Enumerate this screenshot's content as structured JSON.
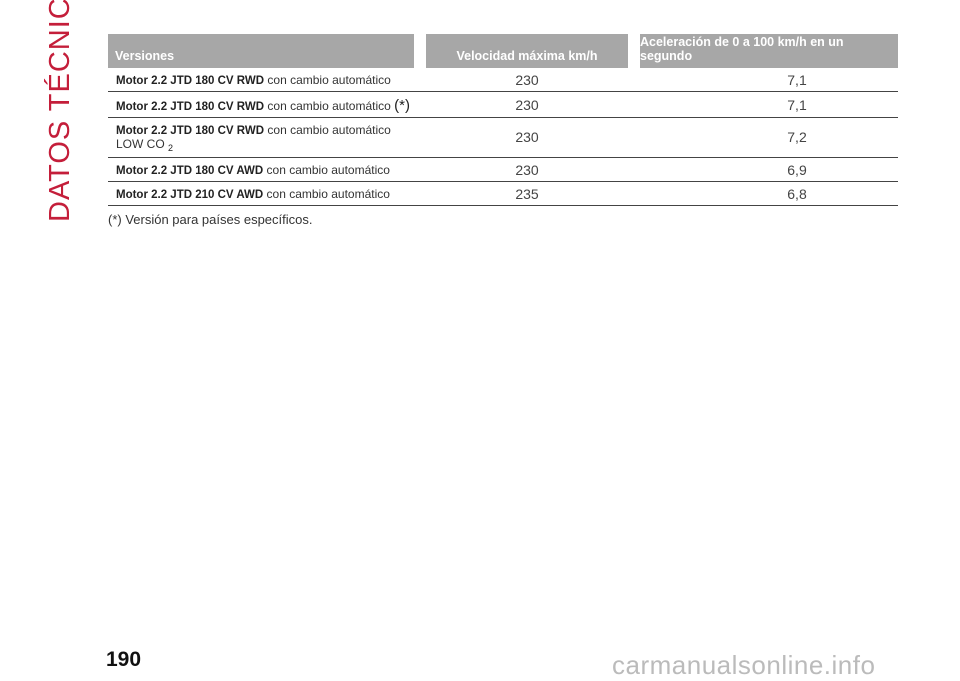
{
  "section_title": "DATOS TÉCNICOS",
  "table": {
    "headers": [
      "Versiones",
      "Velocidad máxima km/h",
      "Aceleración de 0 a 100 km/h en un segundo"
    ],
    "rows": [
      {
        "model": "Motor 2.2 JTD 180 CV RWD",
        "detail": "con cambio automático",
        "note": "",
        "extra": "",
        "sub": "",
        "speed": "230",
        "accel": "7,1"
      },
      {
        "model": "Motor 2.2 JTD 180 CV RWD",
        "detail": "con cambio automático",
        "note": "(*)",
        "extra": "",
        "sub": "",
        "speed": "230",
        "accel": "7,1"
      },
      {
        "model": "Motor 2.2 JTD 180 CV RWD",
        "detail": "con cambio automático",
        "note": "",
        "extra": "LOW CO",
        "sub": "2",
        "speed": "230",
        "accel": "7,2"
      },
      {
        "model": "Motor 2.2 JTD 180 CV AWD",
        "detail": "con cambio automático",
        "note": "",
        "extra": "",
        "sub": "",
        "speed": "230",
        "accel": "6,9"
      },
      {
        "model": "Motor 2.2 JTD 210 CV AWD",
        "detail": "con cambio automático",
        "note": "",
        "extra": "",
        "sub": "",
        "speed": "235",
        "accel": "6,8"
      }
    ]
  },
  "footnote": "(*) Versión para países específicos.",
  "page_number": "190",
  "watermark": "carmanualsonline.info"
}
